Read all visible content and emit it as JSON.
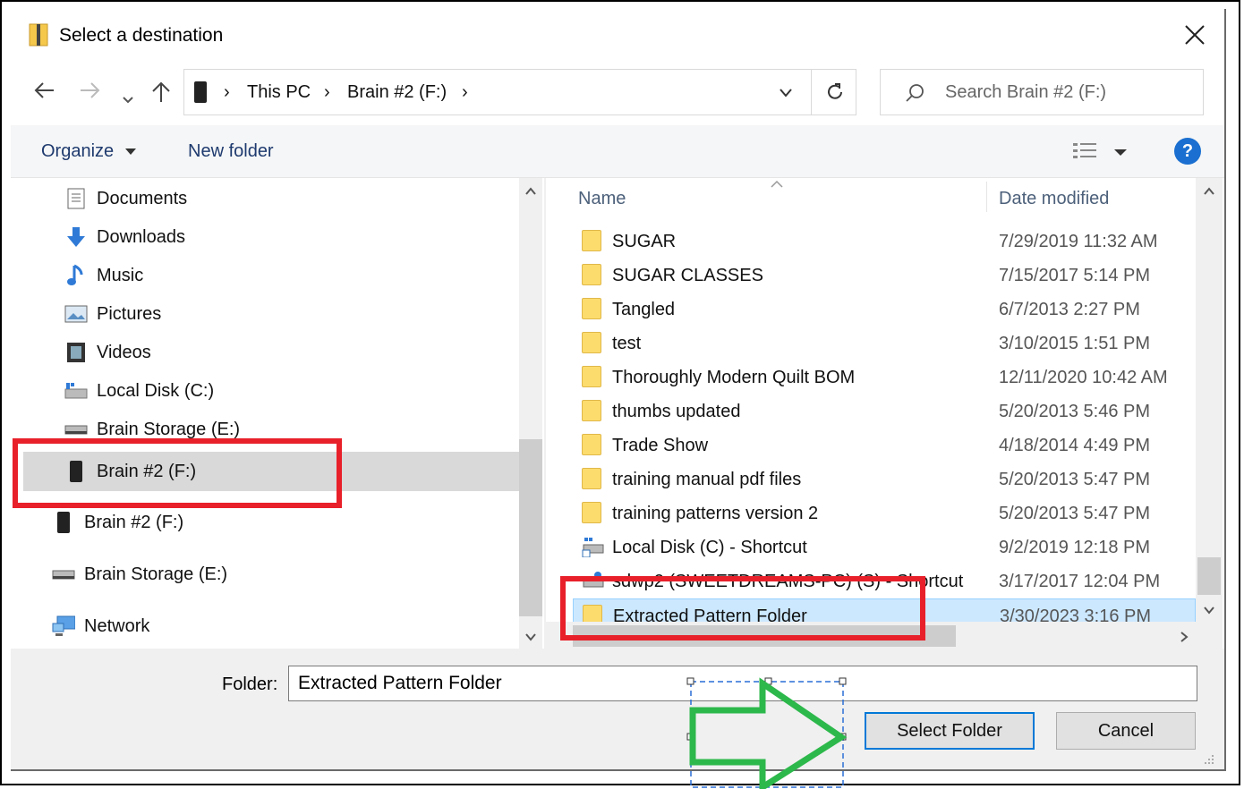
{
  "window": {
    "title": "Select a destination"
  },
  "address": {
    "crumbs": [
      "This PC",
      "Brain #2 (F:)"
    ]
  },
  "search": {
    "placeholder": "Search Brain #2 (F:)"
  },
  "toolbar": {
    "organize": "Organize",
    "new_folder": "New folder"
  },
  "nav_pane": {
    "items": [
      {
        "label": "Documents",
        "icon": "documents-icon"
      },
      {
        "label": "Downloads",
        "icon": "downloads-icon"
      },
      {
        "label": "Music",
        "icon": "music-icon"
      },
      {
        "label": "Pictures",
        "icon": "pictures-icon"
      },
      {
        "label": "Videos",
        "icon": "videos-icon"
      },
      {
        "label": "Local Disk (C:)",
        "icon": "local-disk-icon"
      },
      {
        "label": "Brain Storage (E:)",
        "icon": "drive-icon"
      },
      {
        "label": "Brain #2 (F:)",
        "icon": "usb-drive-icon",
        "selected": true
      },
      {
        "label": "Brain #2 (F:)",
        "icon": "usb-drive-icon"
      },
      {
        "label": "Brain Storage (E:)",
        "icon": "drive-icon"
      },
      {
        "label": "Network",
        "icon": "network-icon"
      }
    ]
  },
  "file_list": {
    "columns": {
      "name": "Name",
      "date": "Date modified"
    },
    "rows": [
      {
        "name": "SUGAR",
        "date": "7/29/2019 11:32 AM",
        "icon": "folder-icon"
      },
      {
        "name": "SUGAR CLASSES",
        "date": "7/15/2017 5:14 PM",
        "icon": "folder-icon"
      },
      {
        "name": "Tangled",
        "date": "6/7/2013 2:27 PM",
        "icon": "folder-icon"
      },
      {
        "name": "test",
        "date": "3/10/2015 1:51 PM",
        "icon": "folder-icon"
      },
      {
        "name": "Thoroughly Modern Quilt BOM",
        "date": "12/11/2020 10:42 AM",
        "icon": "folder-icon"
      },
      {
        "name": "thumbs updated",
        "date": "5/20/2013 5:46 PM",
        "icon": "folder-icon"
      },
      {
        "name": "Trade Show",
        "date": "4/18/2014 4:49 PM",
        "icon": "folder-icon"
      },
      {
        "name": "training manual pdf files",
        "date": "5/20/2013 5:47 PM",
        "icon": "folder-icon"
      },
      {
        "name": "training patterns version 2",
        "date": "5/20/2013 5:47 PM",
        "icon": "folder-icon"
      },
      {
        "name": "Local Disk (C) - Shortcut",
        "date": "9/2/2019 12:18 PM",
        "icon": "shortcut-icon"
      },
      {
        "name": "sdwp2 (SWEETDREAMS-PC) (S) - Shortcut",
        "date": "3/17/2017 12:04 PM",
        "icon": "network-shortcut-icon"
      },
      {
        "name": "Extracted Pattern Folder",
        "date": "3/30/2023 3:16 PM",
        "icon": "folder-icon",
        "selected": true
      }
    ]
  },
  "bottom": {
    "folder_label": "Folder:",
    "folder_value": "Extracted Pattern Folder",
    "select_button": "Select Folder",
    "cancel_button": "Cancel"
  },
  "annotations": {
    "highlight_color": "#e8202a",
    "arrow_color": "#2db84b"
  }
}
